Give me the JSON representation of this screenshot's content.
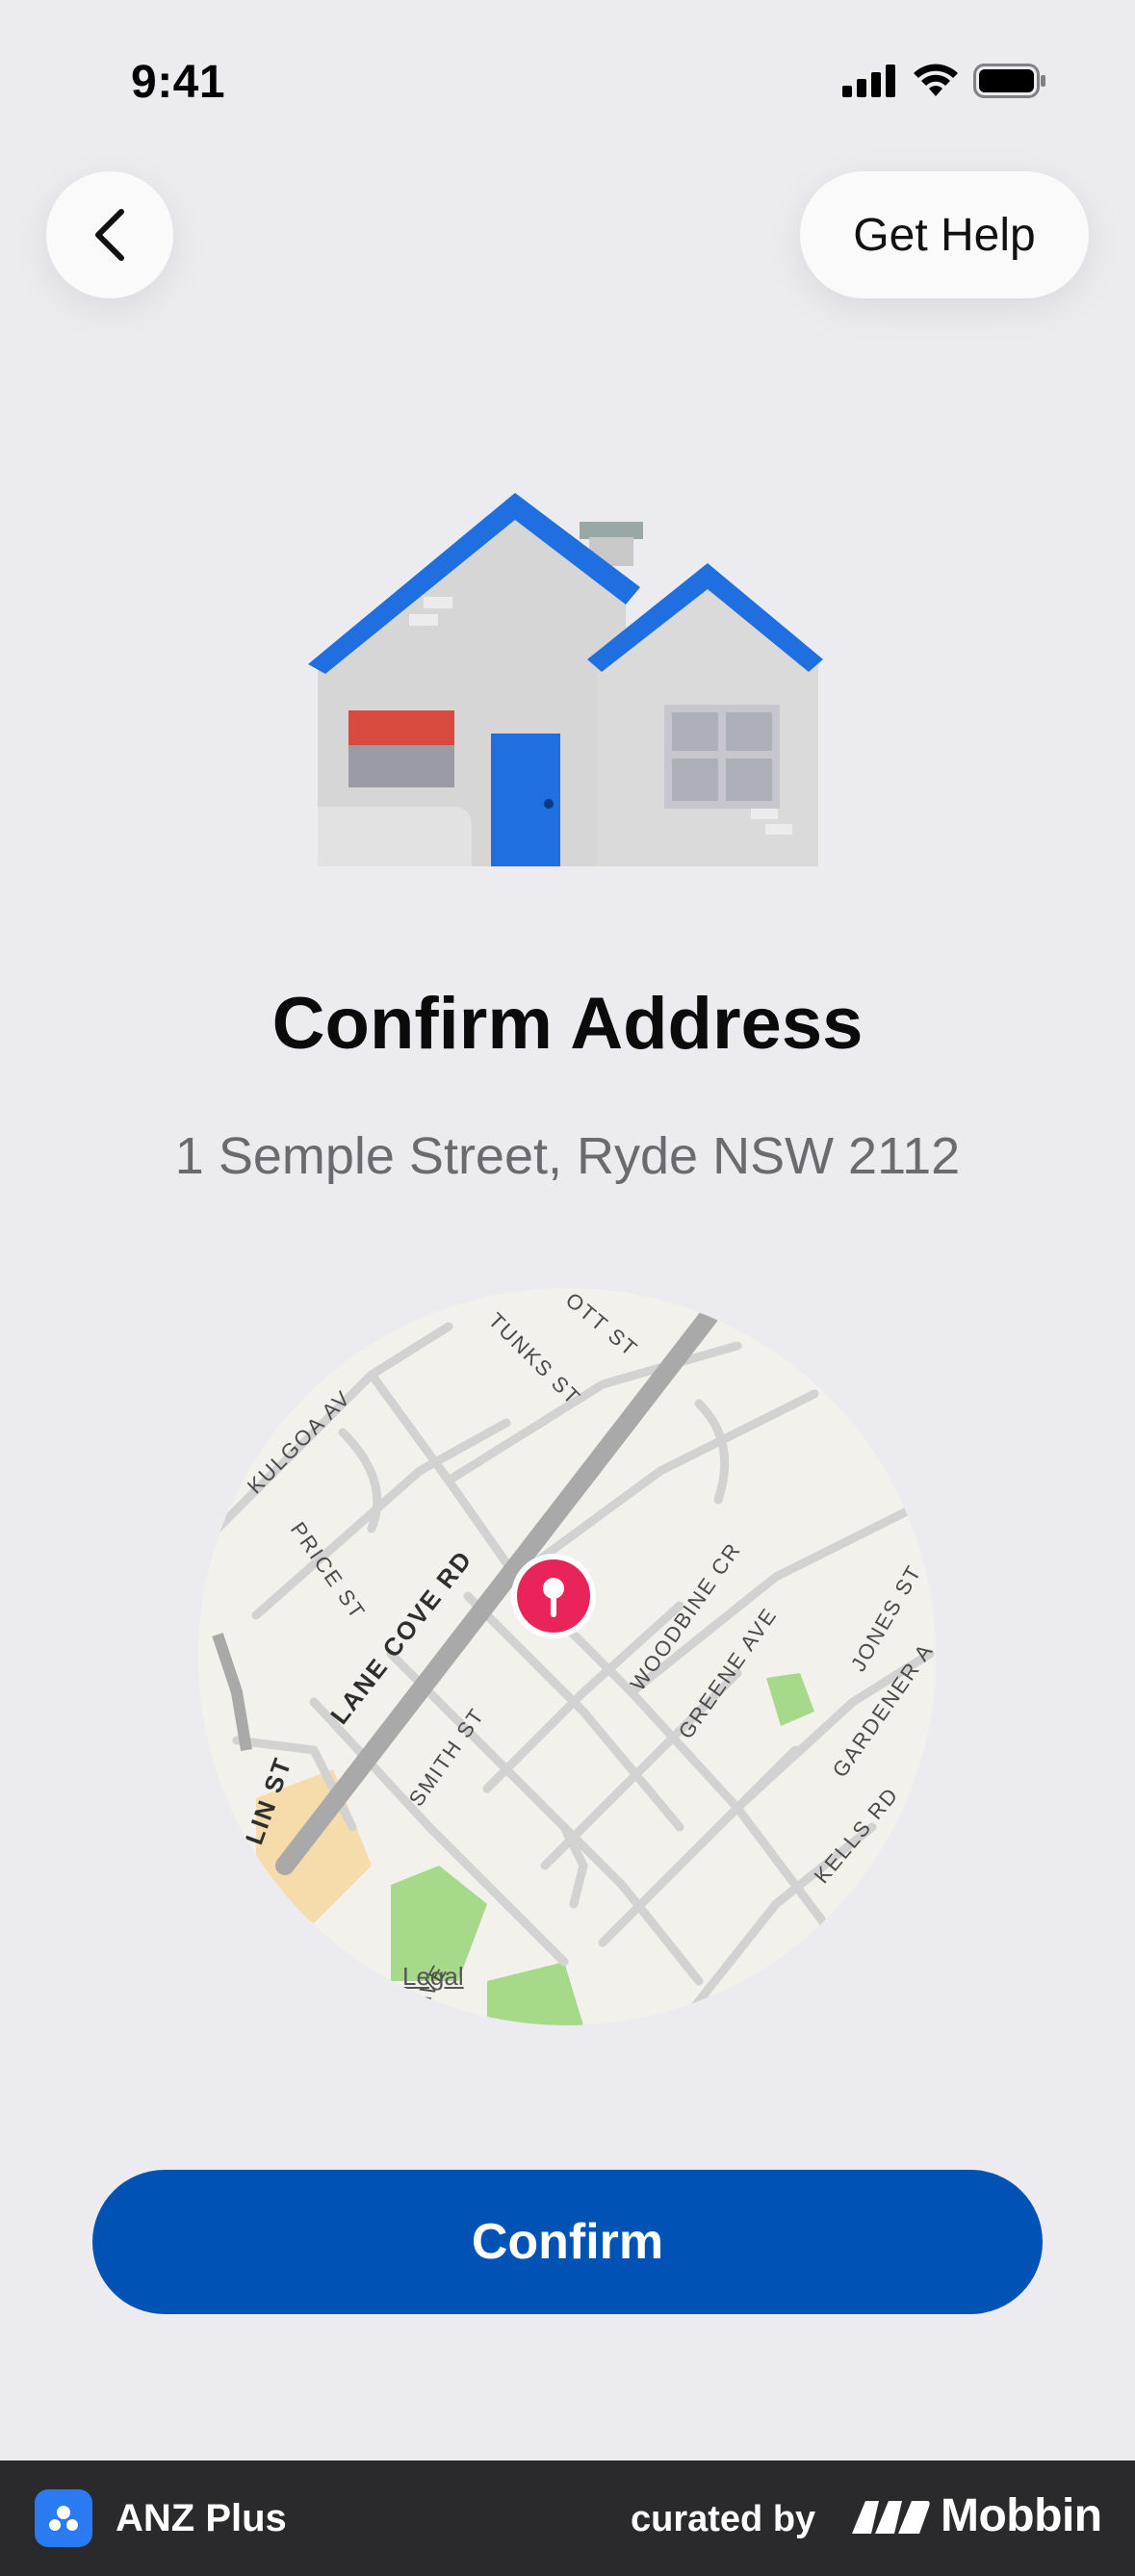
{
  "status_bar": {
    "time": "9:41"
  },
  "nav": {
    "help_label": "Get Help"
  },
  "content": {
    "title": "Confirm Address",
    "address": "1 Semple Street, Ryde NSW 2112"
  },
  "map": {
    "legal_label": "Legal",
    "street_labels": {
      "kulgoa": "KULGOA AV",
      "tunks": "TUNKS ST",
      "ott": "OTT ST",
      "price": "PRICE ST",
      "lane_cove": "LANE COVE RD",
      "woodbine": "WOODBINE CR",
      "greene": "GREENE AVE",
      "jones": "JONES ST",
      "gardener": "GARDENER A",
      "smith": "SMITH ST",
      "lin": "LIN ST",
      "kells": "KELLS RD",
      "ave": "AVE"
    },
    "pin_color": "#e8245a"
  },
  "actions": {
    "confirm_label": "Confirm"
  },
  "footer": {
    "app_name": "ANZ Plus",
    "curated_by": "curated by",
    "brand": "Mobbin"
  },
  "colors": {
    "background": "#ebebf0",
    "primary": "#0053b4",
    "roof": "#1f6fe0",
    "footer_bg": "#2a2a2c"
  }
}
